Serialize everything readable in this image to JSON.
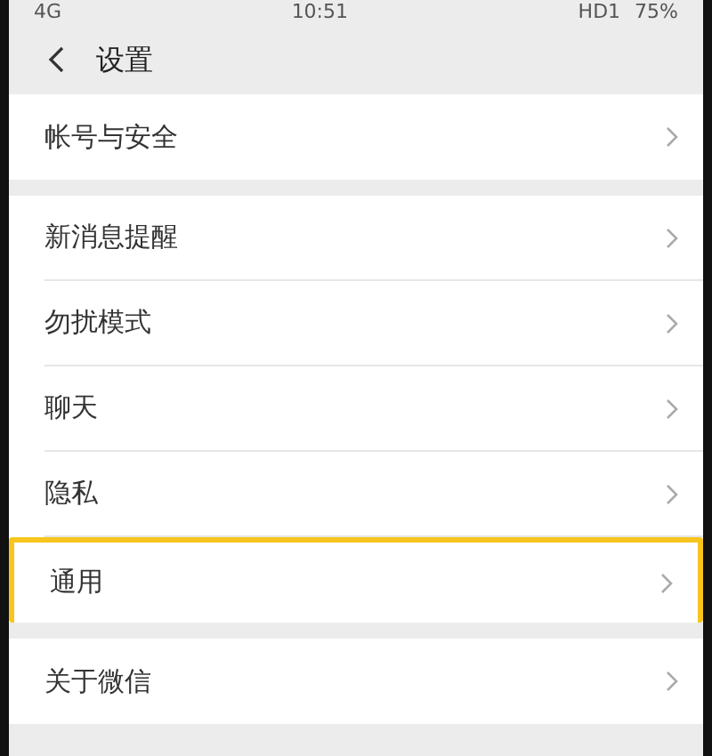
{
  "status_bar": {
    "network": "4G",
    "time": "10:51",
    "hd": "HD1",
    "battery": "75%"
  },
  "header": {
    "title": "设置"
  },
  "sections": [
    {
      "items": [
        {
          "label": "帐号与安全",
          "highlighted": false
        }
      ]
    },
    {
      "items": [
        {
          "label": "新消息提醒",
          "highlighted": false
        },
        {
          "label": "勿扰模式",
          "highlighted": false
        },
        {
          "label": "聊天",
          "highlighted": false
        },
        {
          "label": "隐私",
          "highlighted": false
        },
        {
          "label": "通用",
          "highlighted": true
        }
      ]
    },
    {
      "items": [
        {
          "label": "关于微信",
          "highlighted": false
        }
      ]
    }
  ]
}
